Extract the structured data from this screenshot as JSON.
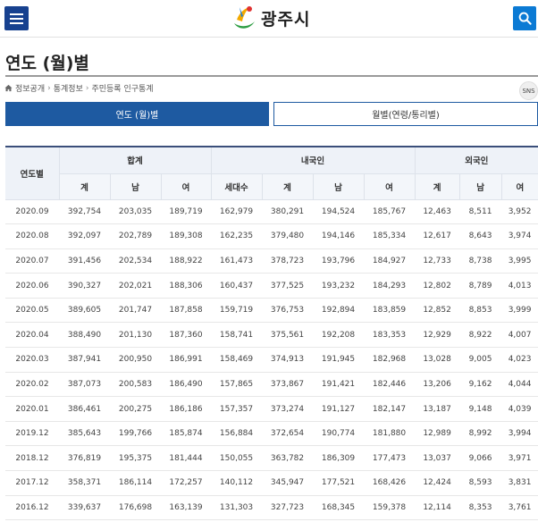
{
  "header": {
    "logo_text": "광주시",
    "menu_icon": "hamburger-menu-icon",
    "search_icon": "search-icon",
    "brand_blue": "#17418f",
    "search_blue": "#0b7ad4"
  },
  "page": {
    "title": "연도 (월)별"
  },
  "breadcrumb": {
    "home_icon": "home-icon",
    "items": [
      "정보공개",
      "통계정보",
      "주민등록 인구통계"
    ]
  },
  "sns": {
    "label": "SNS"
  },
  "tabs": [
    {
      "label": "연도 (월)별",
      "active": true
    },
    {
      "label": "월별(연령/통리별)",
      "active": false
    }
  ],
  "table": {
    "row_header": "연도별",
    "groups": [
      "합계",
      "내국인",
      "외국인"
    ],
    "sub_headers": [
      "계",
      "남",
      "여",
      "세대수",
      "계",
      "남",
      "여",
      "계",
      "남",
      "여"
    ],
    "rows": [
      [
        "2020.09",
        "392,754",
        "203,035",
        "189,719",
        "162,979",
        "380,291",
        "194,524",
        "185,767",
        "12,463",
        "8,511",
        "3,952"
      ],
      [
        "2020.08",
        "392,097",
        "202,789",
        "189,308",
        "162,235",
        "379,480",
        "194,146",
        "185,334",
        "12,617",
        "8,643",
        "3,974"
      ],
      [
        "2020.07",
        "391,456",
        "202,534",
        "188,922",
        "161,473",
        "378,723",
        "193,796",
        "184,927",
        "12,733",
        "8,738",
        "3,995"
      ],
      [
        "2020.06",
        "390,327",
        "202,021",
        "188,306",
        "160,437",
        "377,525",
        "193,232",
        "184,293",
        "12,802",
        "8,789",
        "4,013"
      ],
      [
        "2020.05",
        "389,605",
        "201,747",
        "187,858",
        "159,719",
        "376,753",
        "192,894",
        "183,859",
        "12,852",
        "8,853",
        "3,999"
      ],
      [
        "2020.04",
        "388,490",
        "201,130",
        "187,360",
        "158,741",
        "375,561",
        "192,208",
        "183,353",
        "12,929",
        "8,922",
        "4,007"
      ],
      [
        "2020.03",
        "387,941",
        "200,950",
        "186,991",
        "158,469",
        "374,913",
        "191,945",
        "182,968",
        "13,028",
        "9,005",
        "4,023"
      ],
      [
        "2020.02",
        "387,073",
        "200,583",
        "186,490",
        "157,865",
        "373,867",
        "191,421",
        "182,446",
        "13,206",
        "9,162",
        "4,044"
      ],
      [
        "2020.01",
        "386,461",
        "200,275",
        "186,186",
        "157,357",
        "373,274",
        "191,127",
        "182,147",
        "13,187",
        "9,148",
        "4,039"
      ],
      [
        "2019.12",
        "385,643",
        "199,766",
        "185,874",
        "156,884",
        "372,654",
        "190,774",
        "181,880",
        "12,989",
        "8,992",
        "3,994"
      ],
      [
        "2018.12",
        "376,819",
        "195,375",
        "181,444",
        "150,055",
        "363,782",
        "186,309",
        "177,473",
        "13,037",
        "9,066",
        "3,971"
      ],
      [
        "2017.12",
        "358,371",
        "186,114",
        "172,257",
        "140,112",
        "345,947",
        "177,521",
        "168,426",
        "12,424",
        "8,593",
        "3,831"
      ],
      [
        "2016.12",
        "339,637",
        "176,698",
        "163,139",
        "131,303",
        "327,723",
        "168,345",
        "159,378",
        "12,114",
        "8,353",
        "3,761"
      ]
    ]
  }
}
